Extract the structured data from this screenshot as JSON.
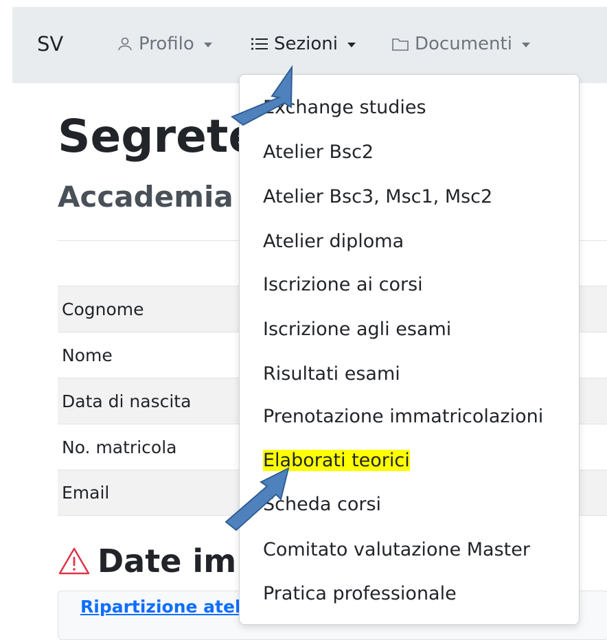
{
  "navbar": {
    "brand": "SV",
    "items": [
      {
        "label": "Profilo",
        "icon": "person-icon"
      },
      {
        "label": "Sezioni",
        "icon": "list-icon"
      },
      {
        "label": "Documenti",
        "icon": "folder-icon"
      }
    ]
  },
  "main": {
    "title": "Segrete",
    "subtitle": "Accademia",
    "table_rows": [
      "Cognome",
      "Nome",
      "Data di nascita",
      "No. matricola",
      "Email"
    ],
    "section_title": "Date im",
    "section_icon": "warning-icon",
    "card_link": "Ripartizione atel"
  },
  "dropdown": {
    "items": [
      "Exchange studies",
      "Atelier Bsc2",
      "Atelier Bsc3, Msc1, Msc2",
      "Atelier diploma",
      "Iscrizione ai corsi",
      "Iscrizione agli esami",
      "Risultati esami",
      "Prenotazione immatricolazioni",
      "Elaborati teorici",
      "Scheda corsi",
      "Comitato valutazione Master",
      "Pratica professionale"
    ],
    "highlighted_index": 8
  },
  "colors": {
    "highlight": "#ffff00",
    "arrow_fill": "#4f81bd",
    "link": "#0d6efd",
    "warning": "#dc3545"
  }
}
